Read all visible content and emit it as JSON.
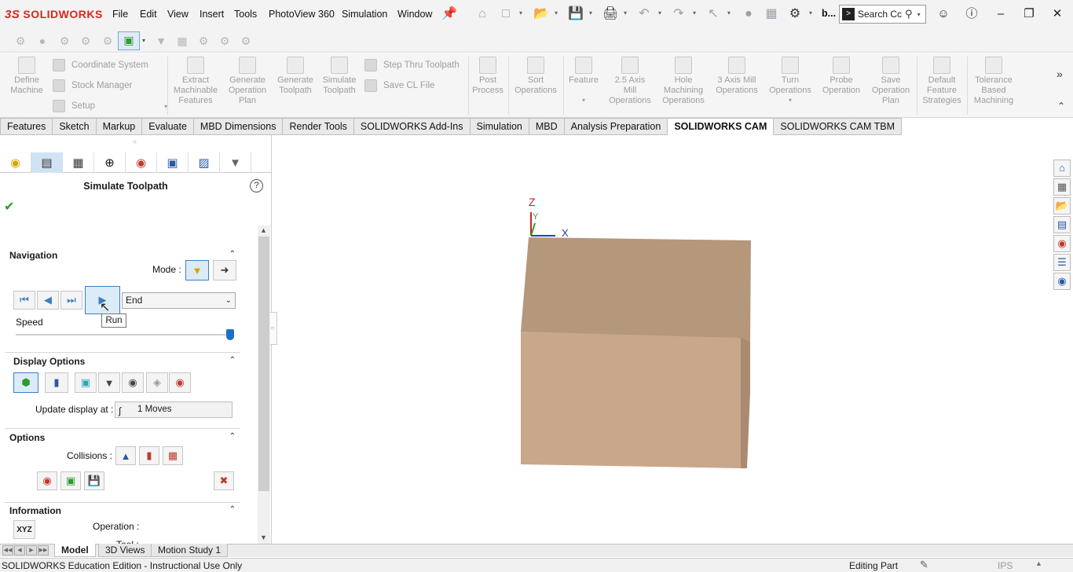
{
  "app": {
    "brand": "SOLIDWORKS",
    "brand_mark": "3S",
    "menu": [
      "File",
      "Edit",
      "View",
      "Insert",
      "Tools",
      "PhotoView 360",
      "Simulation",
      "Window"
    ],
    "user_short": "b...",
    "search_placeholder": "Search Cc",
    "search_icon": "search-icon"
  },
  "command_manager": {
    "items": [
      {
        "label": "Define\nMachine"
      },
      {
        "label": "Extract\nMachinable\nFeatures"
      },
      {
        "label": "Generate\nOperation\nPlan"
      },
      {
        "label": "Generate\nToolpath"
      },
      {
        "label": "Simulate\nToolpath"
      },
      {
        "label": "Post\nProcess"
      },
      {
        "label": "Sort\nOperations"
      },
      {
        "label": "Feature"
      },
      {
        "label": "2.5 Axis\nMill\nOperations"
      },
      {
        "label": "Hole\nMachining\nOperations"
      },
      {
        "label": "3 Axis Mill\nOperations"
      },
      {
        "label": "Turn\nOperations"
      },
      {
        "label": "Probe\nOperation"
      },
      {
        "label": "Save\nOperation\nPlan"
      },
      {
        "label": "Default\nFeature\nStrategies"
      },
      {
        "label": "Tolerance\nBased\nMachining"
      }
    ],
    "rows": {
      "coordinate_system": "Coordinate System",
      "stock_manager": "Stock Manager",
      "setup": "Setup",
      "step_thru": "Step Thru Toolpath",
      "save_cl": "Save CL File"
    }
  },
  "tabs": [
    {
      "label": "Features",
      "active": false
    },
    {
      "label": "Sketch",
      "active": false
    },
    {
      "label": "Markup",
      "active": false
    },
    {
      "label": "Evaluate",
      "active": false
    },
    {
      "label": "MBD Dimensions",
      "active": false
    },
    {
      "label": "Render Tools",
      "active": false
    },
    {
      "label": "SOLIDWORKS Add-Ins",
      "active": false
    },
    {
      "label": "Simulation",
      "active": false
    },
    {
      "label": "MBD",
      "active": false
    },
    {
      "label": "Analysis Preparation",
      "active": false
    },
    {
      "label": "SOLIDWORKS CAM",
      "active": true
    },
    {
      "label": "SOLIDWORKS CAM TBM",
      "active": false
    }
  ],
  "property_manager": {
    "title": "Simulate Toolpath",
    "help": "?",
    "navigation": {
      "heading": "Navigation",
      "mode_label": "Mode :",
      "run_mode_value": "End",
      "tooltip": "Run",
      "speed_label": "Speed",
      "speed_fraction": 1.0
    },
    "display_options": {
      "heading": "Display Options",
      "update_label": "Update display at :",
      "update_value": "1 Moves"
    },
    "options": {
      "heading": "Options",
      "collisions_label": "Collisions :"
    },
    "information": {
      "heading": "Information",
      "xyz_label": "XYZ",
      "operation_label": "Operation :",
      "tool_label": "Tool :"
    }
  },
  "bottom_tabs": [
    {
      "label": "Model",
      "active": true
    },
    {
      "label": "3D Views",
      "active": false
    },
    {
      "label": "Motion Study 1",
      "active": false
    }
  ],
  "status": {
    "edition": "SOLIDWORKS Education Edition - Instructional Use Only",
    "mode": "Editing Part",
    "units": "IPS"
  },
  "viewport": {
    "axis_z": "Z",
    "axis_y": "Y",
    "axis_x": "X",
    "part_color": "#b5977c"
  }
}
